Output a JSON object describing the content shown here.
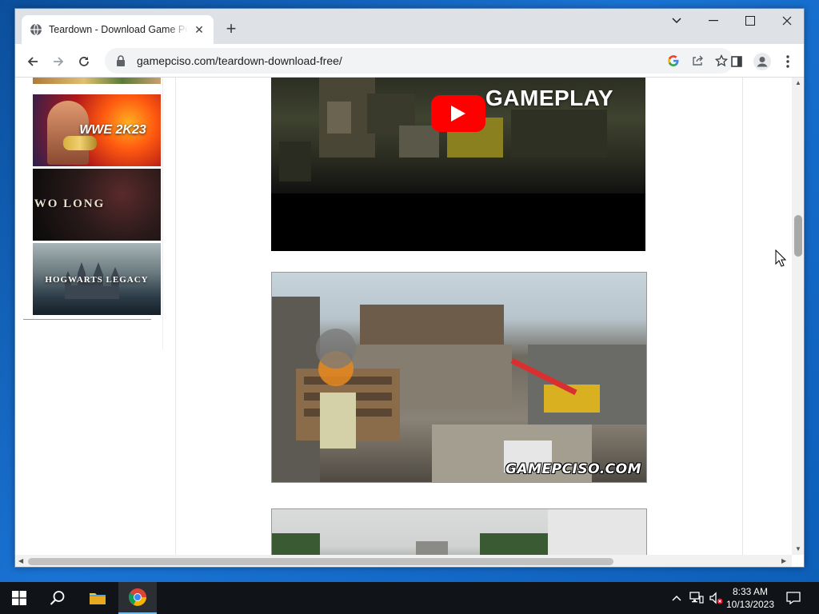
{
  "browser": {
    "tab_title": "Teardown - Download Game PC Iso",
    "url": "gamepciso.com/teardown-download-free/"
  },
  "sidebar": {
    "thumbnails": [
      {
        "label": "WWE 2K23"
      },
      {
        "label": "WO LONG"
      },
      {
        "label": "HOGWARTS LEGACY"
      }
    ]
  },
  "main": {
    "video_title": "GAMEPLAY",
    "screenshot_watermark": "GAMEPCISO.COM"
  },
  "taskbar": {
    "time": "8:33 AM",
    "date": "10/13/2023"
  },
  "colors": {
    "youtube_red": "#ff0000",
    "taskbar": "#101418",
    "accent": "#76b9ed"
  }
}
